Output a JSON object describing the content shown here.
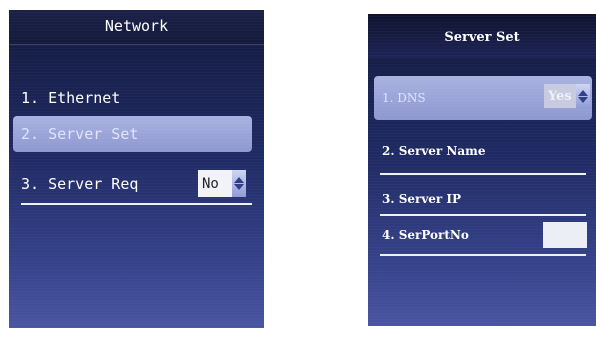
{
  "left_screen": {
    "title": "Network",
    "items": [
      {
        "label": "1. Ethernet"
      },
      {
        "label": "2. Server Set",
        "selected": true
      },
      {
        "label": "3. Server Req",
        "value": "No"
      }
    ]
  },
  "right_screen": {
    "title": "Server Set",
    "items": [
      {
        "label": "1. DNS",
        "value": "Yes",
        "selected": true
      },
      {
        "label": "2. Server Name"
      },
      {
        "label": "3. Server IP"
      },
      {
        "label": "4. SerPortNo",
        "value": ""
      }
    ]
  },
  "colors": {
    "screen_bg_top": "#131a3c",
    "screen_bg_bottom": "#4a55a0",
    "selection": "#a9b2e0",
    "text": "#ffffff"
  }
}
